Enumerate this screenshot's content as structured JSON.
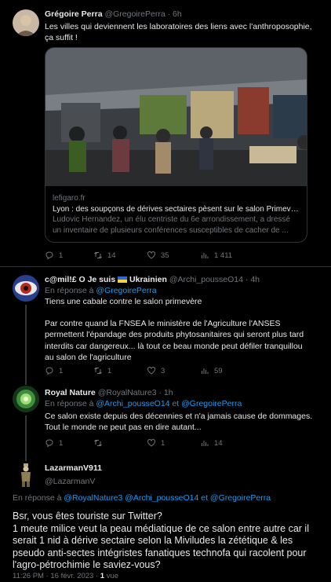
{
  "tweets": [
    {
      "name": "Grégoire Perra",
      "handle": "@GregoirePerra",
      "sep": "·",
      "time": "6h",
      "text": "Les villes qui deviennent les laboratoires des liens avec l'anthroposophie, ça suffit !",
      "card": {
        "domain": "lefigaro.fr",
        "title": "Lyon : des soupçons de dérives sectaires pèsent sur le salon Primevère ...",
        "desc": "Ludovic Hernandez, un élu centriste du 6e arrondissement, a dressé un inventaire de plusieurs conférences susceptibles de cacher de ..."
      },
      "actions": {
        "replies": "1",
        "retweets": "14",
        "likes": "35",
        "views": "1 411"
      }
    },
    {
      "name": "c@mil!£ O Je suis",
      "flag_label": "Ukrainien",
      "handle": "@Archi_pousseO14",
      "sep": "·",
      "time": "4h",
      "reply_prefix": "En réponse à",
      "reply_to": "@GregoirePerra",
      "text1": "Tiens une cabale contre le salon primevère",
      "text2": "Par contre quand la FNSEA le ministère de l'Agriculture l'ANSES permettent l'épandage des produits phytosanitaires qui seront plus tard interdits car dangereux... là tout ce beau monde peut défiler tranquillou au salon de l'agriculture",
      "actions": {
        "replies": "1",
        "retweets": "1",
        "likes": "3",
        "views": "59"
      }
    },
    {
      "name": "Royal Nature",
      "handle": "@RoyalNature3",
      "sep": "·",
      "time": "1h",
      "reply_prefix": "En réponse à",
      "reply_to_1": "@Archi_pousseO14",
      "reply_and": "et",
      "reply_to_2": "@GregoirePerra",
      "text": "Ce salon existe depuis des décennies et n'a jamais cause de dommages. Tout le monde ne peut pas en dire autant...",
      "actions": {
        "replies": "1",
        "retweets": "",
        "likes": "1",
        "views": "14"
      }
    }
  ],
  "main": {
    "name": "LazarmanV911",
    "handle": "@LazarmanV",
    "reply_prefix": "En réponse à",
    "reply_to_1": "@RoyalNature3",
    "reply_to_2": "@Archi_pousseO14",
    "reply_and": "et",
    "reply_to_3": "@GregoirePerra",
    "text": "Bsr, vous êtes touriste sur Twitter?\n1 meute milice veut la peau médiatique de ce salon entre autre car il serait 1 nid à dérive sectaire selon la Miviludes la zététique & les pseudo anti-sectes intégristes fanatiques technofa qui racolent pour l'agro-pétrochimie le saviez-vous?",
    "time": "11:26 PM · 16 févr. 2023 ·",
    "views_count": "1",
    "views_label": "vue"
  },
  "colors": {
    "link": "#1d9bf0",
    "muted": "#71767b",
    "text": "#e7e9ea",
    "bg": "#000000"
  },
  "icons": [
    "reply-icon",
    "retweet-icon",
    "like-icon",
    "views-icon"
  ]
}
